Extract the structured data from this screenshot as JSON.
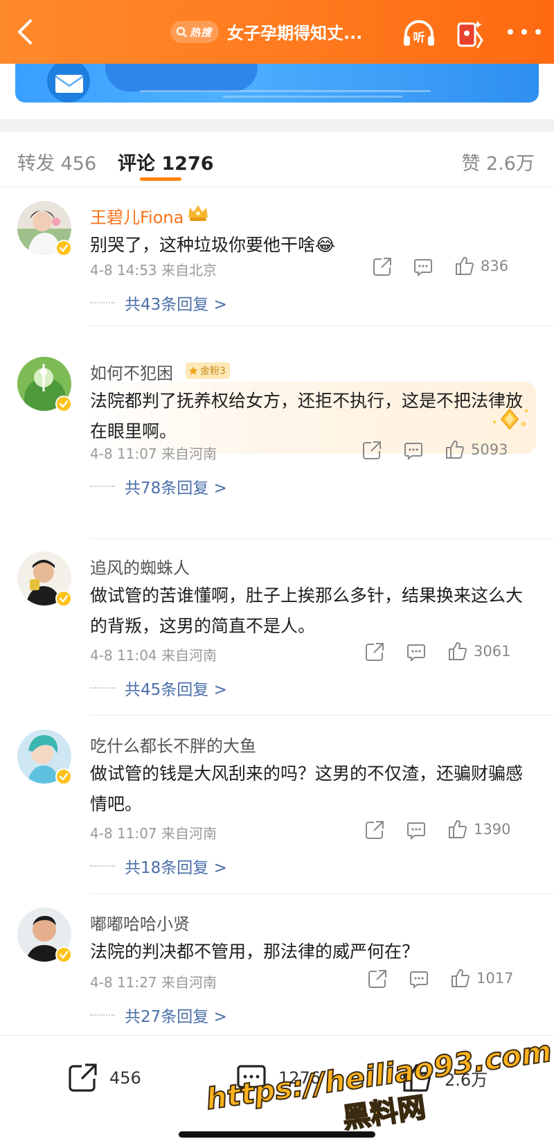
{
  "header": {
    "hot_tag": "热搜",
    "title": "女子孕期得知丈...",
    "listen_label": "听"
  },
  "tabs": {
    "repost": "转发 456",
    "comment": "评论 1276",
    "like": "赞 2.6万"
  },
  "colors": {
    "brand_orange": "#ff7a1e",
    "link_blue": "#4a6ea8",
    "vip_name": "#f7731a"
  },
  "comments": [
    {
      "user": "王碧儿Fiona",
      "text": "别哭了，这种垃圾你要他干啥",
      "emoji": "😂",
      "time_loc": "4-8 14:53  来自北京",
      "likes": "836",
      "replies": "共43条回复 >"
    },
    {
      "user": "如何不犯困",
      "badge": "金粉3",
      "text": "法院都判了抚养权给女方，还拒不执行，这是不把法律放在眼里啊。",
      "time_loc": "4-8 11:07  来自河南",
      "likes": "5093",
      "replies": "共78条回复 >"
    },
    {
      "user": "追风的蜘蛛人",
      "text": "做试管的苦谁懂啊，肚子上挨那么多针，结果换来这么大的背叛，这男的简直不是人。",
      "time_loc": "4-8 11:04  来自河南",
      "likes": "3061",
      "replies": "共45条回复 >"
    },
    {
      "user": "吃什么都长不胖的大鱼",
      "text": "做试管的钱是大风刮来的吗？这男的不仅渣，还骗财骗感情吧。",
      "time_loc": "4-8 11:07  来自河南",
      "likes": "1390",
      "replies": "共18条回复 >"
    },
    {
      "user": "嘟嘟哈哈小贤",
      "text": "法院的判决都不管用，那法律的威严何在？",
      "time_loc": "4-8 11:27  来自河南",
      "likes": "1017",
      "replies": "共27条回复 >"
    }
  ],
  "bottom": {
    "repost": "456",
    "comment": "1276",
    "like": "2.6万"
  },
  "watermark": {
    "url": "https://heiliao93.com",
    "name": "黑料网"
  }
}
